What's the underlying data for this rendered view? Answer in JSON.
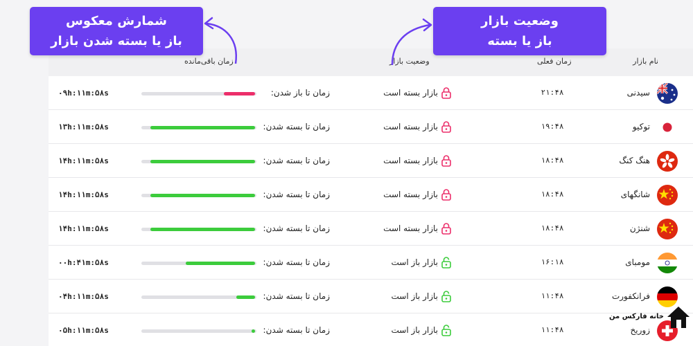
{
  "header": {
    "market_name": "نام بازار",
    "current_time": "زمان فعلی",
    "market_status": "وضعیت بازار",
    "time_remaining": "زمان باقی‌مانده"
  },
  "callouts": {
    "left": {
      "line1": "شمارش معکوس",
      "line2": "باز یا بسته شدن بازار"
    },
    "right": {
      "line1": "وضعیت بازار",
      "line2": "باز یا بسته"
    }
  },
  "colors": {
    "accent": "#6b3ff0",
    "open": "#3ccc3c",
    "closed": "#ec2e6a",
    "track": "#e0e0e4"
  },
  "markets": [
    {
      "name": "سیدنی",
      "flag": "flag-australia-icon",
      "time": "۲۱:۴۸",
      "status": "بازار بسته است",
      "open": false,
      "count_label": "زمان تا باز شدن:",
      "remaining": "۰۹h:۱۱m:۵۸s",
      "progress": 0.27,
      "bar_color": "#ec2e6a"
    },
    {
      "name": "توکیو",
      "flag": "flag-japan-icon",
      "time": "۱۹:۴۸",
      "status": "بازار بسته است",
      "open": false,
      "count_label": "زمان تا بسته شدن:",
      "remaining": "۱۳h:۱۱m:۵۸s",
      "progress": 0.91,
      "bar_color": "#3ccc3c"
    },
    {
      "name": "هنگ کنگ",
      "flag": "flag-hongkong-icon",
      "time": "۱۸:۴۸",
      "status": "بازار بسته است",
      "open": false,
      "count_label": "زمان تا بسته شدن:",
      "remaining": "۱۴h:۱۱m:۵۸s",
      "progress": 0.91,
      "bar_color": "#3ccc3c"
    },
    {
      "name": "شانگهای",
      "flag": "flag-china-icon",
      "time": "۱۸:۴۸",
      "status": "بازار بسته است",
      "open": false,
      "count_label": "زمان تا بسته شدن:",
      "remaining": "۱۴h:۱۱m:۵۸s",
      "progress": 0.91,
      "bar_color": "#3ccc3c"
    },
    {
      "name": "شنژن",
      "flag": "flag-china-icon",
      "time": "۱۸:۴۸",
      "status": "بازار بسته است",
      "open": false,
      "count_label": "زمان تا بسته شدن:",
      "remaining": "۱۴h:۱۱m:۵۸s",
      "progress": 0.91,
      "bar_color": "#3ccc3c"
    },
    {
      "name": "مومبای",
      "flag": "flag-india-icon",
      "time": "۱۶:۱۸",
      "status": "بازار باز است",
      "open": true,
      "count_label": "زمان تا بسته شدن:",
      "remaining": "۰۰h:۴۱m:۵۸s",
      "progress": 0.6,
      "bar_color": "#3ccc3c"
    },
    {
      "name": "فرانکفورت",
      "flag": "flag-germany-icon",
      "time": "۱۱:۴۸",
      "status": "بازار باز است",
      "open": true,
      "count_label": "زمان تا بسته شدن:",
      "remaining": "۰۴h:۱۱m:۵۸s",
      "progress": 0.16,
      "bar_color": "#3ccc3c"
    },
    {
      "name": "زوریخ",
      "flag": "flag-switzerland-icon",
      "time": "۱۱:۴۸",
      "status": "بازار باز است",
      "open": true,
      "count_label": "زمان تا بسته شدن:",
      "remaining": "۰۵h:۱۱m:۵۸s",
      "progress": 0.03,
      "bar_color": "#3ccc3c"
    }
  ],
  "brand": {
    "name": "خانه فارکس من"
  }
}
